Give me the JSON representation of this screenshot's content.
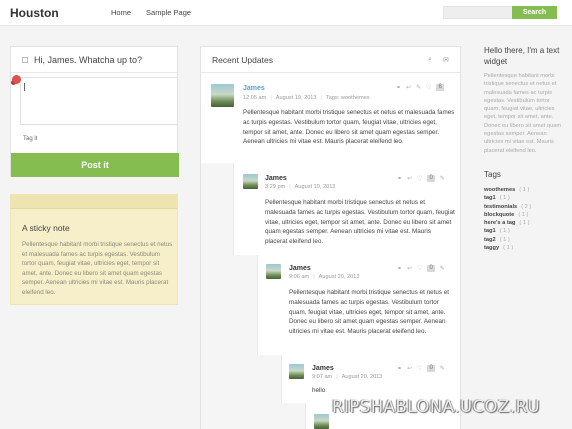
{
  "header": {
    "logo": "Houston",
    "nav": [
      "Home",
      "Sample Page"
    ],
    "search_button": "Search"
  },
  "post_box": {
    "prompt": "Hi, James. Whatcha up to?",
    "tag_placeholder": "Tag it",
    "post_button": "Post it"
  },
  "sticky_note": {
    "title": "A sticky note",
    "text": "Pellentesque habitant morbi tristique senectus et netus et malesuada fames ac turpis egestas. Vestibulum tortor quam, feugiat vitae, ultricies eget, tempor sit amet, ante. Donec eu libero sit amet quam egestas semper. Aenean ultricies mi vitae est. Mauris placerat eleifend leo."
  },
  "updates": {
    "title": "Recent Updates",
    "entries": [
      {
        "name": "James",
        "time": "12:05 am",
        "date": "August 19, 2013",
        "tags": "Tags: woothemes",
        "count": "6",
        "text": "Pellentesque habitant morbi tristique senectus et netus et malesuada fames ac turpis egestas. Vestibulum tortor quam, feugiat vitae, ultricies eget, tempor sit amet, ante. Donec eu libero sit amet quam egestas semper. Aenean ultricies mi vitae est. Mauris placerat eleifend leo."
      },
      {
        "name": "James",
        "time": "3:29 pm",
        "date": "August 19, 2013",
        "count": "0",
        "text": "Pellentesque habitant morbi tristique senectus et netus et malesuada fames ac turpis egestas. Vestibulum tortor quam, feugiat vitae, ultricies eget, tempor sit amet, ante. Donec eu libero sit amet quam egestas semper. Aenean ultricies mi vitae est. Mauris placerat eleifend leo."
      },
      {
        "name": "James",
        "time": "9:06 am",
        "date": "August 20, 2013",
        "count": "0",
        "text": "Pellentesque habitant morbi tristique senectus et netus et malesuada fames ac turpis egestas. Vestibulum tortor quam, feugiat vitae, ultricies eget, tempor sit amet, ante. Donec eu libero sit amet quam egestas semper. Aenean ultricies mi vitae est. Mauris placerat eleifend leo."
      },
      {
        "name": "James",
        "time": "9:07 am",
        "date": "August 20, 2013",
        "count": "0",
        "text": "hello"
      }
    ]
  },
  "sidebar": {
    "widget_title": "Hello there, I'm a text widget",
    "widget_text": "Pellentesque habitant morbi tristique senectus et netus et malesuada fames ac turpis egestas. Vestibulum tortor quam, feugiat vitae, ultricies eget, tempor sit amet, ante. Donec eu libero sit amet quam egestas semper. Aenean ultricies mi vitae est. Mauris placerat eleifend leo.",
    "tags_title": "Tags",
    "tags": [
      {
        "name": "woothemes",
        "count": "( 1 )"
      },
      {
        "name": "tag1",
        "count": "( 1 )"
      },
      {
        "name": "testimonials",
        "count": "( 2 )"
      },
      {
        "name": "blockquote",
        "count": "( 1 )"
      },
      {
        "name": "here's a tag",
        "count": "( 1 )"
      },
      {
        "name": "tag1",
        "count": "( 1 )"
      },
      {
        "name": "tag2",
        "count": "( 1 )"
      },
      {
        "name": "taggy",
        "count": "( 1 )"
      }
    ]
  },
  "watermark": "RIPSHABLONA.UCOZ.RU",
  "colors": {
    "accent_green": "#85bd51",
    "link_blue": "#5aa0c8",
    "sticky_yellow": "#f6efc9"
  }
}
